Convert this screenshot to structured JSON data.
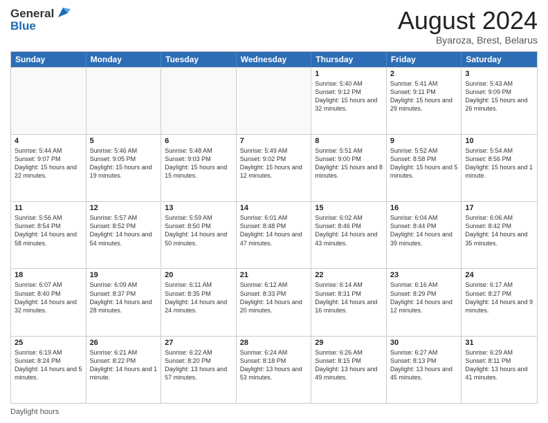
{
  "logo": {
    "general": "General",
    "blue": "Blue"
  },
  "header": {
    "month_year": "August 2024",
    "location": "Byaroza, Brest, Belarus"
  },
  "days_of_week": [
    "Sunday",
    "Monday",
    "Tuesday",
    "Wednesday",
    "Thursday",
    "Friday",
    "Saturday"
  ],
  "footer": {
    "daylight_label": "Daylight hours"
  },
  "weeks": [
    [
      {
        "day": "",
        "info": ""
      },
      {
        "day": "",
        "info": ""
      },
      {
        "day": "",
        "info": ""
      },
      {
        "day": "",
        "info": ""
      },
      {
        "day": "1",
        "info": "Sunrise: 5:40 AM\nSunset: 9:12 PM\nDaylight: 15 hours and 32 minutes."
      },
      {
        "day": "2",
        "info": "Sunrise: 5:41 AM\nSunset: 9:11 PM\nDaylight: 15 hours and 29 minutes."
      },
      {
        "day": "3",
        "info": "Sunrise: 5:43 AM\nSunset: 9:09 PM\nDaylight: 15 hours and 26 minutes."
      }
    ],
    [
      {
        "day": "4",
        "info": "Sunrise: 5:44 AM\nSunset: 9:07 PM\nDaylight: 15 hours and 22 minutes."
      },
      {
        "day": "5",
        "info": "Sunrise: 5:46 AM\nSunset: 9:05 PM\nDaylight: 15 hours and 19 minutes."
      },
      {
        "day": "6",
        "info": "Sunrise: 5:48 AM\nSunset: 9:03 PM\nDaylight: 15 hours and 15 minutes."
      },
      {
        "day": "7",
        "info": "Sunrise: 5:49 AM\nSunset: 9:02 PM\nDaylight: 15 hours and 12 minutes."
      },
      {
        "day": "8",
        "info": "Sunrise: 5:51 AM\nSunset: 9:00 PM\nDaylight: 15 hours and 8 minutes."
      },
      {
        "day": "9",
        "info": "Sunrise: 5:52 AM\nSunset: 8:58 PM\nDaylight: 15 hours and 5 minutes."
      },
      {
        "day": "10",
        "info": "Sunrise: 5:54 AM\nSunset: 8:56 PM\nDaylight: 15 hours and 1 minute."
      }
    ],
    [
      {
        "day": "11",
        "info": "Sunrise: 5:56 AM\nSunset: 8:54 PM\nDaylight: 14 hours and 58 minutes."
      },
      {
        "day": "12",
        "info": "Sunrise: 5:57 AM\nSunset: 8:52 PM\nDaylight: 14 hours and 54 minutes."
      },
      {
        "day": "13",
        "info": "Sunrise: 5:59 AM\nSunset: 8:50 PM\nDaylight: 14 hours and 50 minutes."
      },
      {
        "day": "14",
        "info": "Sunrise: 6:01 AM\nSunset: 8:48 PM\nDaylight: 14 hours and 47 minutes."
      },
      {
        "day": "15",
        "info": "Sunrise: 6:02 AM\nSunset: 8:46 PM\nDaylight: 14 hours and 43 minutes."
      },
      {
        "day": "16",
        "info": "Sunrise: 6:04 AM\nSunset: 8:44 PM\nDaylight: 14 hours and 39 minutes."
      },
      {
        "day": "17",
        "info": "Sunrise: 6:06 AM\nSunset: 8:42 PM\nDaylight: 14 hours and 35 minutes."
      }
    ],
    [
      {
        "day": "18",
        "info": "Sunrise: 6:07 AM\nSunset: 8:40 PM\nDaylight: 14 hours and 32 minutes."
      },
      {
        "day": "19",
        "info": "Sunrise: 6:09 AM\nSunset: 8:37 PM\nDaylight: 14 hours and 28 minutes."
      },
      {
        "day": "20",
        "info": "Sunrise: 6:11 AM\nSunset: 8:35 PM\nDaylight: 14 hours and 24 minutes."
      },
      {
        "day": "21",
        "info": "Sunrise: 6:12 AM\nSunset: 8:33 PM\nDaylight: 14 hours and 20 minutes."
      },
      {
        "day": "22",
        "info": "Sunrise: 6:14 AM\nSunset: 8:31 PM\nDaylight: 14 hours and 16 minutes."
      },
      {
        "day": "23",
        "info": "Sunrise: 6:16 AM\nSunset: 8:29 PM\nDaylight: 14 hours and 12 minutes."
      },
      {
        "day": "24",
        "info": "Sunrise: 6:17 AM\nSunset: 8:27 PM\nDaylight: 14 hours and 9 minutes."
      }
    ],
    [
      {
        "day": "25",
        "info": "Sunrise: 6:19 AM\nSunset: 8:24 PM\nDaylight: 14 hours and 5 minutes."
      },
      {
        "day": "26",
        "info": "Sunrise: 6:21 AM\nSunset: 8:22 PM\nDaylight: 14 hours and 1 minute."
      },
      {
        "day": "27",
        "info": "Sunrise: 6:22 AM\nSunset: 8:20 PM\nDaylight: 13 hours and 57 minutes."
      },
      {
        "day": "28",
        "info": "Sunrise: 6:24 AM\nSunset: 8:18 PM\nDaylight: 13 hours and 53 minutes."
      },
      {
        "day": "29",
        "info": "Sunrise: 6:26 AM\nSunset: 8:15 PM\nDaylight: 13 hours and 49 minutes."
      },
      {
        "day": "30",
        "info": "Sunrise: 6:27 AM\nSunset: 8:13 PM\nDaylight: 13 hours and 45 minutes."
      },
      {
        "day": "31",
        "info": "Sunrise: 6:29 AM\nSunset: 8:11 PM\nDaylight: 13 hours and 41 minutes."
      }
    ]
  ]
}
